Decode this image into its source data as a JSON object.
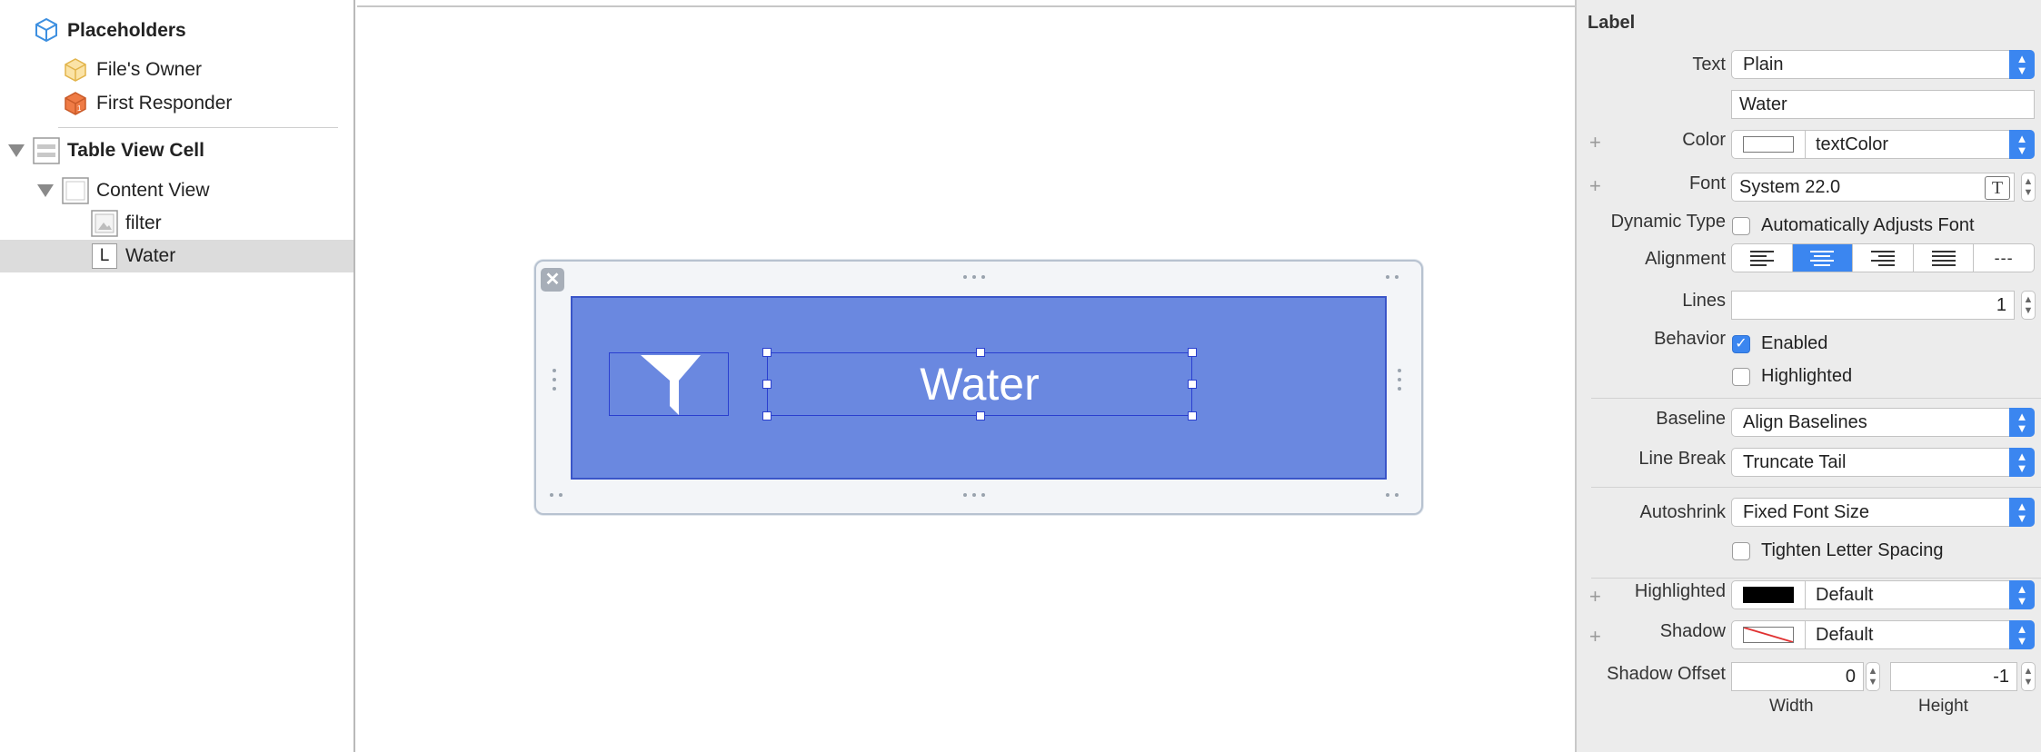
{
  "outline": {
    "items": [
      {
        "label": "Placeholders",
        "icon": "cube-icon"
      },
      {
        "label": "File's Owner",
        "icon": "cube-icon"
      },
      {
        "label": "First Responder",
        "icon": "first-responder-icon"
      },
      {
        "label": "Table View Cell",
        "icon": "table-cell-icon"
      },
      {
        "label": "Content View",
        "icon": "view-icon"
      },
      {
        "label": "filter",
        "icon": "image-view-icon"
      },
      {
        "label": "Water",
        "icon": "label-icon",
        "icon_text": "L"
      }
    ]
  },
  "canvas": {
    "close_glyph": "✕",
    "label_text": "Water",
    "cell_color": "#6a88e0"
  },
  "inspector": {
    "section_title": "Label",
    "text": {
      "label": "Text",
      "value": "Plain",
      "content": "Water"
    },
    "color": {
      "label": "Color",
      "value": "textColor",
      "plus": "+"
    },
    "font": {
      "label": "Font",
      "value": "System 22.0",
      "plus": "+",
      "button_glyph": "T"
    },
    "dynamic_type": {
      "label": "Dynamic Type",
      "checkbox_label": "Automatically Adjusts Font",
      "checked": false
    },
    "alignment": {
      "label": "Alignment",
      "options": [
        "left",
        "center",
        "right",
        "justified",
        "natural"
      ],
      "selected": "center",
      "natural_glyph": "---"
    },
    "lines": {
      "label": "Lines",
      "value": "1"
    },
    "behavior": {
      "label": "Behavior",
      "enabled_label": "Enabled",
      "enabled": true,
      "highlighted_label": "Highlighted",
      "highlighted": false,
      "check_glyph": "✓"
    },
    "baseline": {
      "label": "Baseline",
      "value": "Align Baselines"
    },
    "line_break": {
      "label": "Line Break",
      "value": "Truncate Tail"
    },
    "autoshrink": {
      "label": "Autoshrink",
      "value": "Fixed Font Size",
      "tighten_label": "Tighten Letter Spacing",
      "tighten": false
    },
    "highlighted_color": {
      "label": "Highlighted",
      "value": "Default",
      "plus": "+"
    },
    "shadow": {
      "label": "Shadow",
      "value": "Default",
      "plus": "+"
    },
    "shadow_offset": {
      "label": "Shadow Offset",
      "width_value": "0",
      "height_value": "-1",
      "width_label": "Width",
      "height_label": "Height"
    },
    "popup_arrow_up": "▲",
    "popup_arrow_down": "▼"
  }
}
